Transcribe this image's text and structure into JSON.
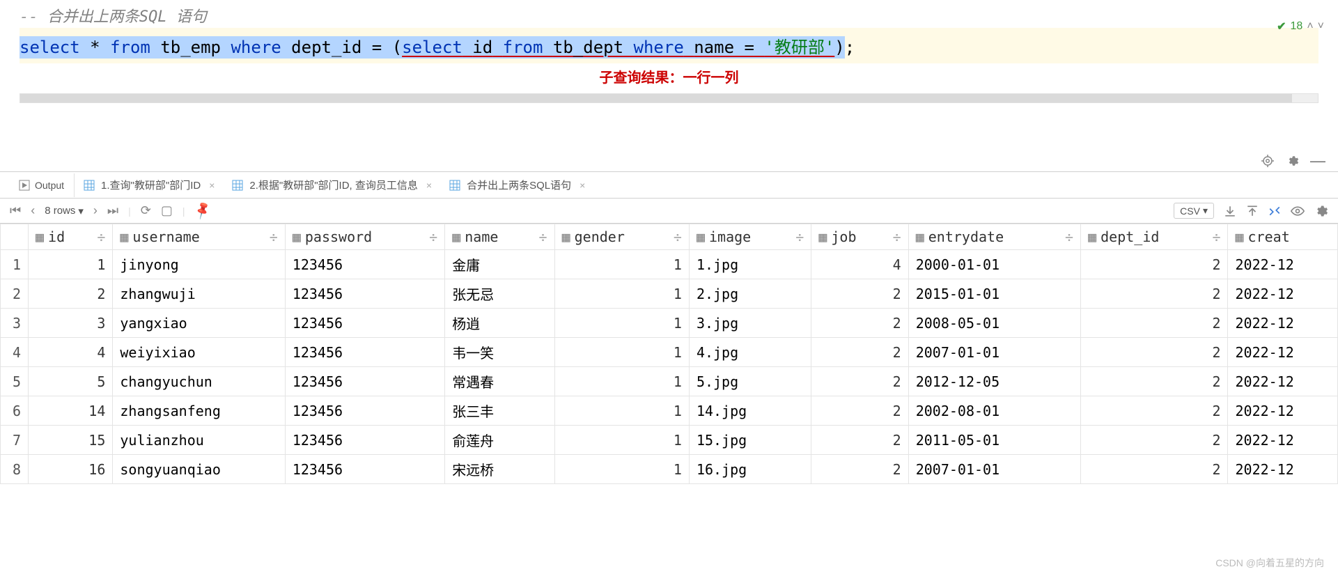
{
  "editor": {
    "comment_prefix": "-- ",
    "comment": "合并出上两条SQL 语句",
    "sql_tokens": {
      "select": "select",
      "star": "*",
      "from": "from",
      "tbl_emp": "tb_emp",
      "where": "where",
      "dept_id": "dept_id",
      "eq": "=",
      "lparen": "(",
      "sub_select": "select",
      "sub_id": "id",
      "sub_from": "from",
      "sub_tbl": "tb_dept",
      "sub_where": "where",
      "sub_name": "name",
      "sub_eq": "=",
      "sub_str": "'教研部'",
      "rparen": ")",
      "semicolon": ";"
    },
    "annotation": "子查询结果：一行一列",
    "status_count": "18"
  },
  "tabs": {
    "output_label": "Output",
    "items": [
      {
        "label": "1.查询\"教研部\"部门ID"
      },
      {
        "label": "2.根据\"教研部\"部门ID, 查询员工信息"
      },
      {
        "label": "合并出上两条SQL语句"
      }
    ]
  },
  "result_toolbar": {
    "rows_label": "8 rows",
    "export_dd": "CSV"
  },
  "table": {
    "columns": [
      "id",
      "username",
      "password",
      "name",
      "gender",
      "image",
      "job",
      "entrydate",
      "dept_id",
      "creat"
    ],
    "rows": [
      {
        "n": "1",
        "id": "1",
        "username": "jinyong",
        "password": "123456",
        "name": "金庸",
        "gender": "1",
        "image": "1.jpg",
        "job": "4",
        "entrydate": "2000-01-01",
        "dept_id": "2",
        "creat": "2022-12"
      },
      {
        "n": "2",
        "id": "2",
        "username": "zhangwuji",
        "password": "123456",
        "name": "张无忌",
        "gender": "1",
        "image": "2.jpg",
        "job": "2",
        "entrydate": "2015-01-01",
        "dept_id": "2",
        "creat": "2022-12"
      },
      {
        "n": "3",
        "id": "3",
        "username": "yangxiao",
        "password": "123456",
        "name": "杨逍",
        "gender": "1",
        "image": "3.jpg",
        "job": "2",
        "entrydate": "2008-05-01",
        "dept_id": "2",
        "creat": "2022-12"
      },
      {
        "n": "4",
        "id": "4",
        "username": "weiyixiao",
        "password": "123456",
        "name": "韦一笑",
        "gender": "1",
        "image": "4.jpg",
        "job": "2",
        "entrydate": "2007-01-01",
        "dept_id": "2",
        "creat": "2022-12"
      },
      {
        "n": "5",
        "id": "5",
        "username": "changyuchun",
        "password": "123456",
        "name": "常遇春",
        "gender": "1",
        "image": "5.jpg",
        "job": "2",
        "entrydate": "2012-12-05",
        "dept_id": "2",
        "creat": "2022-12"
      },
      {
        "n": "6",
        "id": "14",
        "username": "zhangsanfeng",
        "password": "123456",
        "name": "张三丰",
        "gender": "1",
        "image": "14.jpg",
        "job": "2",
        "entrydate": "2002-08-01",
        "dept_id": "2",
        "creat": "2022-12"
      },
      {
        "n": "7",
        "id": "15",
        "username": "yulianzhou",
        "password": "123456",
        "name": "俞莲舟",
        "gender": "1",
        "image": "15.jpg",
        "job": "2",
        "entrydate": "2011-05-01",
        "dept_id": "2",
        "creat": "2022-12"
      },
      {
        "n": "8",
        "id": "16",
        "username": "songyuanqiao",
        "password": "123456",
        "name": "宋远桥",
        "gender": "1",
        "image": "16.jpg",
        "job": "2",
        "entrydate": "2007-01-01",
        "dept_id": "2",
        "creat": "2022-12"
      }
    ]
  },
  "watermark": "CSDN @向着五星的方向"
}
